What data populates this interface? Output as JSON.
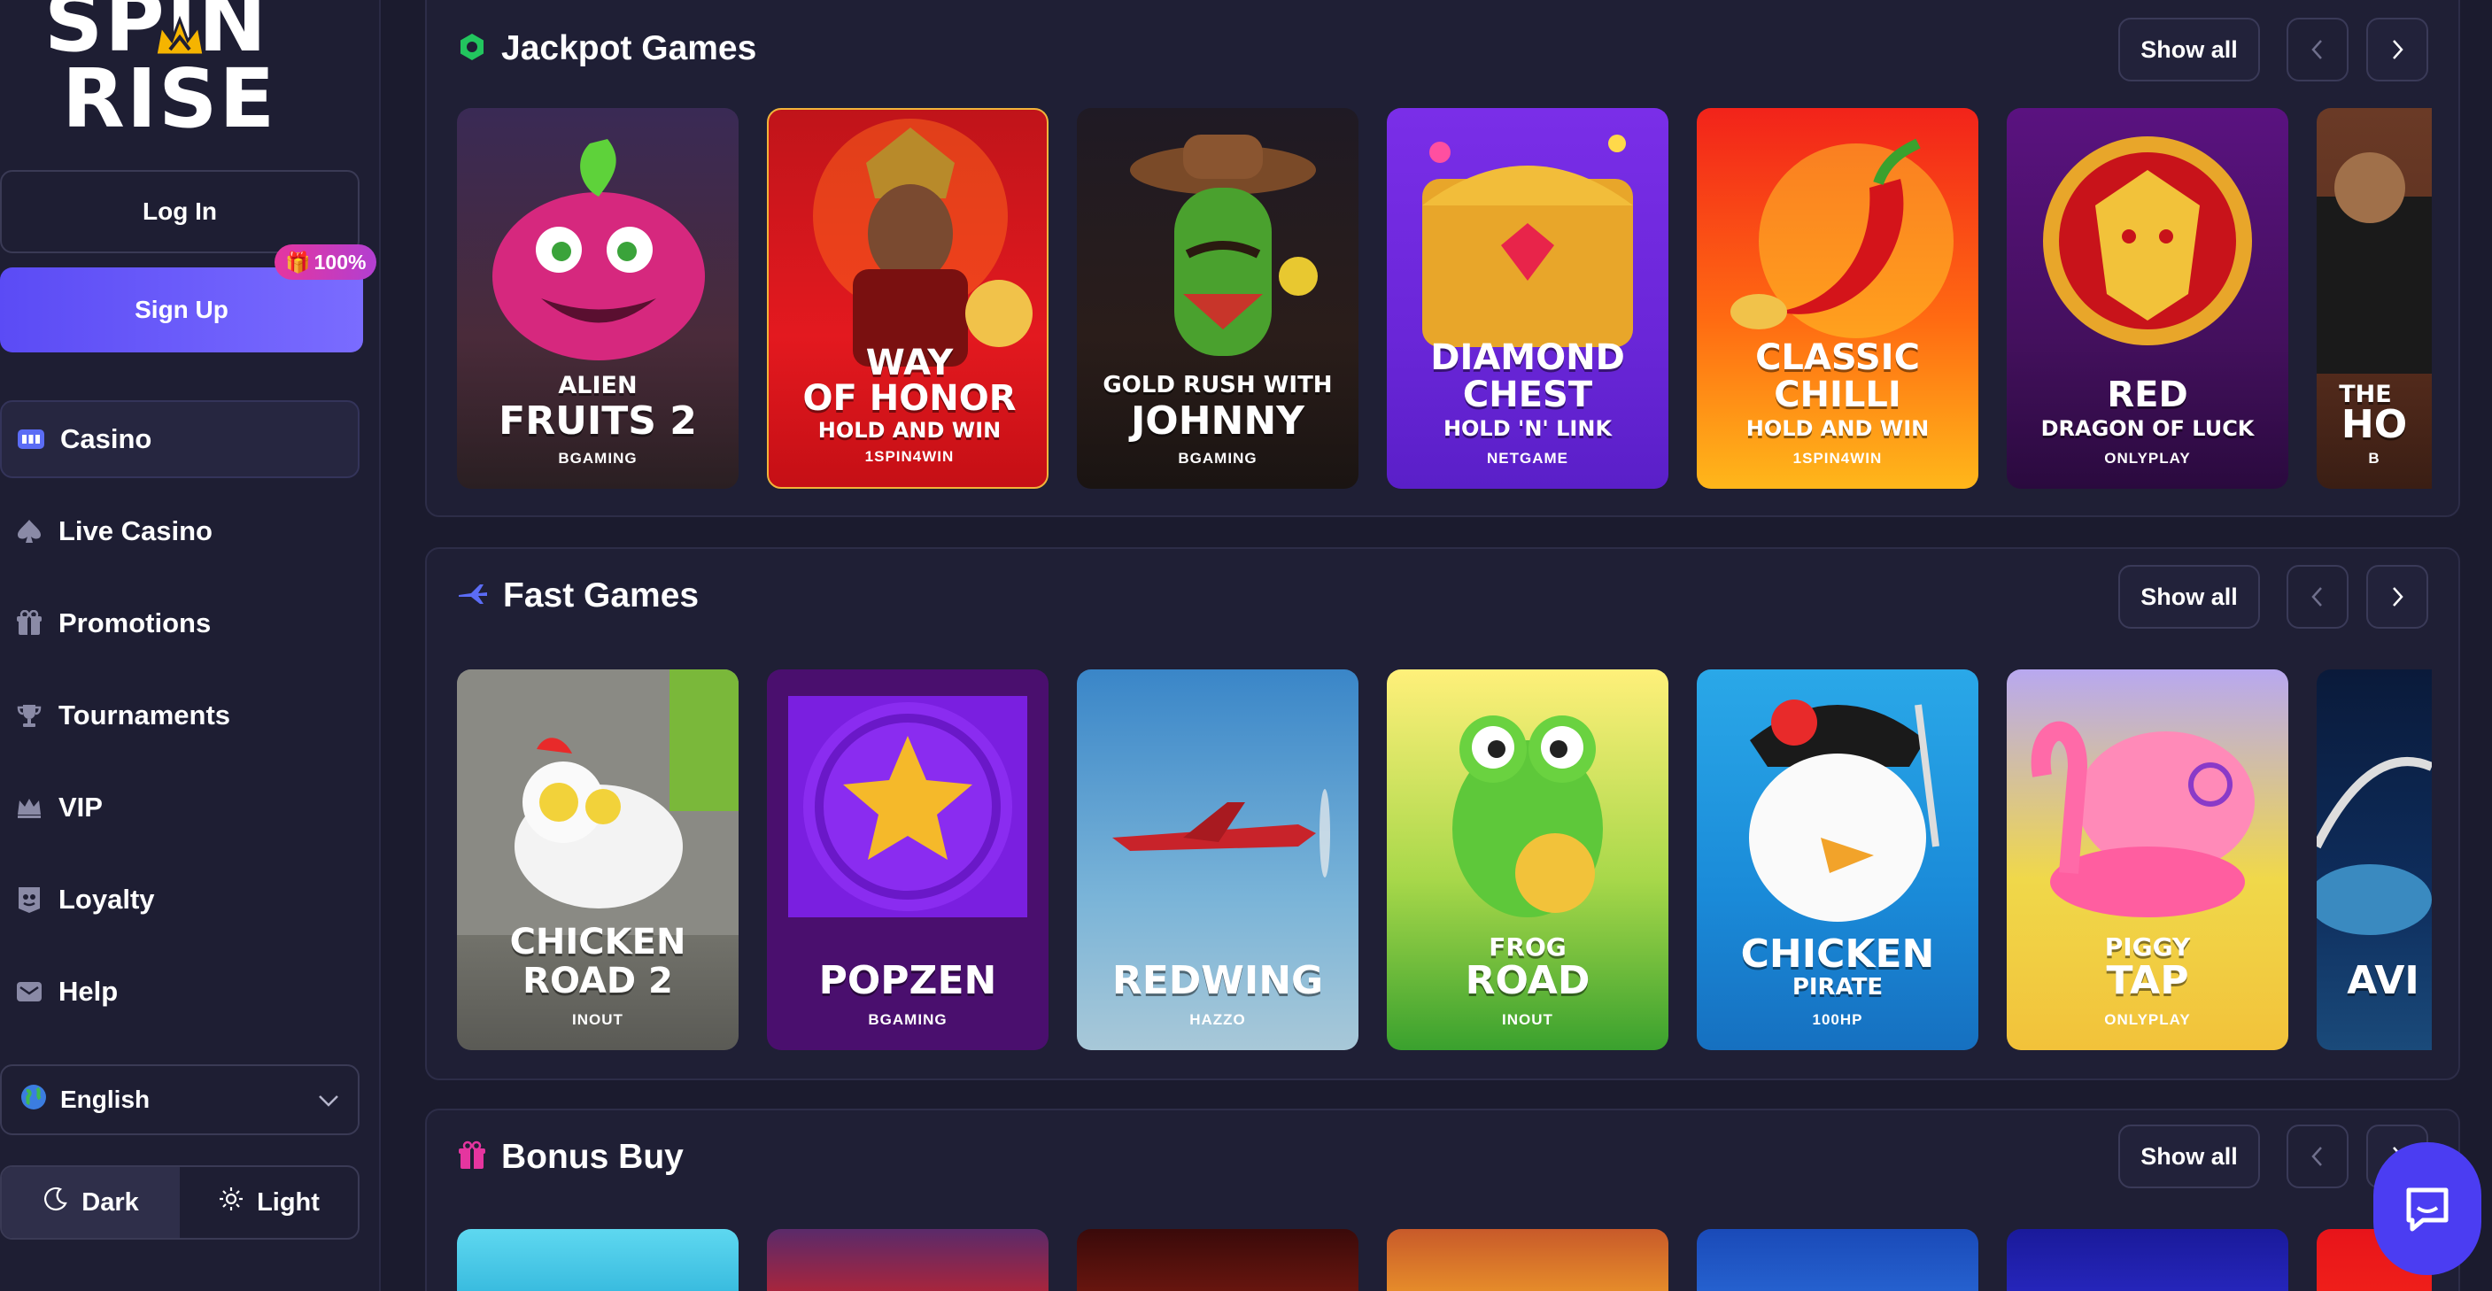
{
  "brand": {
    "line1": "SPIN",
    "line2": "RISE"
  },
  "auth": {
    "login_label": "Log In",
    "signup_label": "Sign Up",
    "bonus_badge": "100%"
  },
  "nav": {
    "items": [
      {
        "label": "Casino",
        "icon": "casino-icon"
      },
      {
        "label": "Live Casino",
        "icon": "spade-icon"
      },
      {
        "label": "Promotions",
        "icon": "gift-icon"
      },
      {
        "label": "Tournaments",
        "icon": "trophy-icon"
      },
      {
        "label": "VIP",
        "icon": "crown-icon"
      },
      {
        "label": "Loyalty",
        "icon": "loyalty-icon"
      },
      {
        "label": "Help",
        "icon": "mail-icon"
      }
    ]
  },
  "language": {
    "selected": "English"
  },
  "theme": {
    "dark_label": "Dark",
    "light_label": "Light",
    "active": "Dark"
  },
  "sections": [
    {
      "title": "Jackpot Games",
      "show_all": "Show all",
      "games": [
        {
          "line_a": "ALIEN",
          "line_b": "FRUITS 2",
          "line_c": "",
          "provider": "BGAMING"
        },
        {
          "line_a": "WAY",
          "line_b": "OF HONOR",
          "line_c": "HOLD AND WIN",
          "provider": "1SPIN4WIN"
        },
        {
          "line_a": "GOLD RUSH WITH",
          "line_b": "JOHNNY",
          "line_c": "",
          "provider": "BGAMING"
        },
        {
          "line_a": "DIAMOND",
          "line_b": "CHEST",
          "line_c": "HOLD 'N' LINK",
          "provider": "NETGAME"
        },
        {
          "line_a": "CLASSIC",
          "line_b": "CHILLI",
          "line_c": "HOLD AND WIN",
          "provider": "1SPIN4WIN"
        },
        {
          "line_a": "RED",
          "line_b": "DRAGON OF LUCK",
          "line_c": "",
          "provider": "ONLYPLAY"
        },
        {
          "line_a": "THE",
          "line_b": "HO",
          "line_c": "",
          "provider": "B"
        }
      ]
    },
    {
      "title": "Fast Games",
      "show_all": "Show all",
      "games": [
        {
          "line_a": "CHICKEN",
          "line_b": "ROAD 2",
          "line_c": "",
          "provider": "INOUT"
        },
        {
          "line_a": "",
          "line_b": "POPZEN",
          "line_c": "",
          "provider": "BGAMING"
        },
        {
          "line_a": "",
          "line_b": "REDWING",
          "line_c": "",
          "provider": "HAZZO"
        },
        {
          "line_a": "FROG",
          "line_b": "ROAD",
          "line_c": "",
          "provider": "INOUT"
        },
        {
          "line_a": "CHICKEN",
          "line_b": "PIRATE",
          "line_c": "",
          "provider": "100HP"
        },
        {
          "line_a": "PIGGY",
          "line_b": "TAP",
          "line_c": "",
          "provider": "ONLYPLAY"
        },
        {
          "line_a": "",
          "line_b": "AVI",
          "line_c": "",
          "provider": ""
        }
      ]
    },
    {
      "title": "Bonus Buy",
      "show_all": "Show all",
      "games": []
    }
  ],
  "colors": {
    "accent": "#5b4bf5",
    "background": "#1b1b2e",
    "panel": "#1f1f35",
    "badge": "#e5359f"
  }
}
